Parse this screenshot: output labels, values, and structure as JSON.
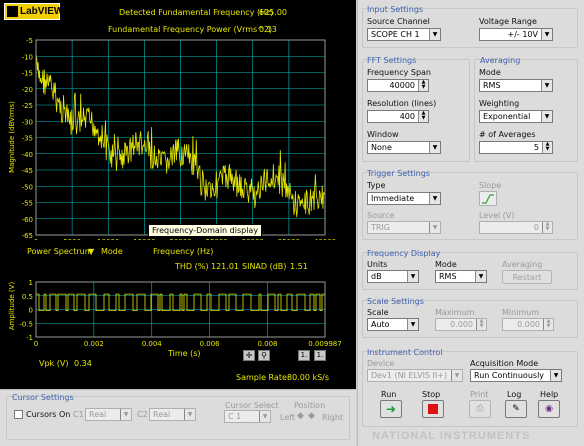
{
  "brand": {
    "name": "LabVIEW"
  },
  "readouts": {
    "fund_freq_label": "Detected Fundamental Frequency (Hz)",
    "fund_freq_value": "625.00",
    "fund_power_label": "Fundamental Frequency Power (Vrms^2)",
    "fund_power_value": "0.13"
  },
  "spectrum_graph": {
    "ylabel": "Magnitude (dBVrms)",
    "xlabel": "Frequency (Hz)",
    "tooltip": "Frequency-Domain display",
    "power_spectrum_label": "Power Spectrum",
    "mode_label": "Mode",
    "yticks": [
      "-5",
      "-10",
      "-15",
      "-20",
      "-25",
      "-30",
      "-35",
      "-40",
      "-45",
      "-50",
      "-55",
      "-60",
      "-65"
    ],
    "xticks": [
      "0",
      "5000",
      "10000",
      "15000",
      "20000",
      "25000",
      "30000",
      "35000",
      "40000"
    ]
  },
  "thd": {
    "thd_label": "THD (%)",
    "thd_value": "121.01",
    "sinad_label": "SINAD (dB)",
    "sinad_value": "1.51"
  },
  "time_graph": {
    "ylabel": "Amplitude (V)",
    "xlabel": "Time (s)",
    "yticks": [
      "1",
      "0.5",
      "0",
      "-0.5",
      "-1"
    ],
    "xticks": [
      "0",
      "0.002",
      "0.004",
      "0.006",
      "0.008",
      "0.009987"
    ]
  },
  "vpk": {
    "label": "Vpk (V)",
    "value": "0.34"
  },
  "sample_rate": {
    "label": "Sample Rate:",
    "value": "80.00 kS/s"
  },
  "cursor_settings": {
    "title": "Cursor Settings",
    "cursors_on": "Cursors On",
    "c1_label": "C1",
    "c1_value": "Real",
    "c2_label": "C2",
    "c2_value": "Real",
    "cursor_select_label": "Cursor Select",
    "cursor_select_value": "C 1",
    "position_label": "Position",
    "left": "Left",
    "right": "Right"
  },
  "input_settings": {
    "title": "Input Settings",
    "source_label": "Source Channel",
    "source_value": "SCOPE CH 1",
    "range_label": "Voltage Range",
    "range_value": "+/- 10V"
  },
  "fft_settings": {
    "title": "FFT Settings",
    "span_label": "Frequency Span",
    "span_value": "40000",
    "res_label": "Resolution (lines)",
    "res_value": "400",
    "window_label": "Window",
    "window_value": "None"
  },
  "averaging": {
    "title": "Averaging",
    "mode_label": "Mode",
    "mode_value": "RMS",
    "weight_label": "Weighting",
    "weight_value": "Exponential",
    "navg_label": "# of Averages",
    "navg_value": "5"
  },
  "trigger": {
    "title": "Trigger Settings",
    "type_label": "Type",
    "type_value": "Immediate",
    "slope_label": "Slope",
    "source_label": "Source",
    "source_value": "TRIG",
    "level_label": "Level (V)",
    "level_value": "0"
  },
  "freq_display": {
    "title": "Frequency Display",
    "units_label": "Units",
    "units_value": "dB",
    "mode_label": "Mode",
    "mode_value": "RMS",
    "avg_label": "Averaging",
    "restart": "Restart"
  },
  "scale": {
    "title": "Scale Settings",
    "scale_label": "Scale",
    "scale_value": "Auto",
    "max_label": "Maximum",
    "max_value": "0.000",
    "min_label": "Minimum",
    "min_value": "0.000"
  },
  "instrument": {
    "title": "Instrument Control",
    "device_label": "Device",
    "device_value": "Dev1 (NI ELVIS II+)",
    "acq_label": "Acquisition Mode",
    "acq_value": "Run Continuously",
    "run": "Run",
    "stop": "Stop",
    "print": "Print",
    "log": "Log",
    "help": "Help"
  },
  "watermark": "NATIONAL INSTRUMENTS",
  "colors": {
    "plot_bg": "#000000",
    "grid": "#00bcbc",
    "trace": "#e6e600",
    "accent": "#3e62ad"
  }
}
